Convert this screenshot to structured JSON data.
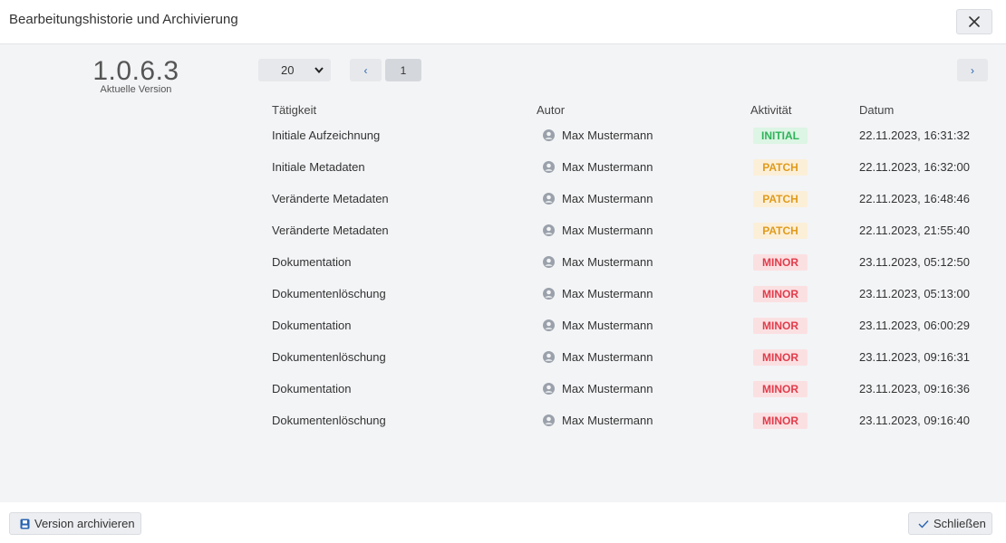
{
  "dialog": {
    "title": "Bearbeitungshistorie und Archivierung"
  },
  "version": {
    "number": "1.0.6.3",
    "label": "Aktuelle Version"
  },
  "pagination": {
    "page_size": "20",
    "prev": "‹",
    "current_page": "1",
    "next": "›"
  },
  "table": {
    "headers": {
      "activity": "Tätigkeit",
      "author": "Autor",
      "type": "Aktivität",
      "date": "Datum"
    },
    "rows": [
      {
        "activity": "Initiale Aufzeichnung",
        "author": "Max Mustermann",
        "type": "INITIAL",
        "date": "22.11.2023, 16:31:32"
      },
      {
        "activity": "Initiale Metadaten",
        "author": "Max Mustermann",
        "type": "PATCH",
        "date": "22.11.2023, 16:32:00"
      },
      {
        "activity": "Veränderte Metadaten",
        "author": "Max Mustermann",
        "type": "PATCH",
        "date": "22.11.2023, 16:48:46"
      },
      {
        "activity": "Veränderte Metadaten",
        "author": "Max Mustermann",
        "type": "PATCH",
        "date": "22.11.2023, 21:55:40"
      },
      {
        "activity": "Dokumentation",
        "author": "Max Mustermann",
        "type": "MINOR",
        "date": "23.11.2023, 05:12:50"
      },
      {
        "activity": "Dokumentenlöschung",
        "author": "Max Mustermann",
        "type": "MINOR",
        "date": "23.11.2023, 05:13:00"
      },
      {
        "activity": "Dokumentation",
        "author": "Max Mustermann",
        "type": "MINOR",
        "date": "23.11.2023, 06:00:29"
      },
      {
        "activity": "Dokumentenlöschung",
        "author": "Max Mustermann",
        "type": "MINOR",
        "date": "23.11.2023, 09:16:31"
      },
      {
        "activity": "Dokumentation",
        "author": "Max Mustermann",
        "type": "MINOR",
        "date": "23.11.2023, 09:16:36"
      },
      {
        "activity": "Dokumentenlöschung",
        "author": "Max Mustermann",
        "type": "MINOR",
        "date": "23.11.2023, 09:16:40"
      }
    ]
  },
  "badge_colors": {
    "INITIAL": {
      "bg": "#dcf5e4",
      "fg": "#2fb35a"
    },
    "PATCH": {
      "bg": "#fcefd8",
      "fg": "#e09b1b"
    },
    "MINOR": {
      "bg": "#fbe0e2",
      "fg": "#e03c4b"
    }
  },
  "footer": {
    "archive_label": "Version archivieren",
    "close_label": "Schließen"
  },
  "icons": {
    "close": "close-icon",
    "user": "user-icon",
    "archive": "save-icon",
    "confirm": "check-icon"
  }
}
